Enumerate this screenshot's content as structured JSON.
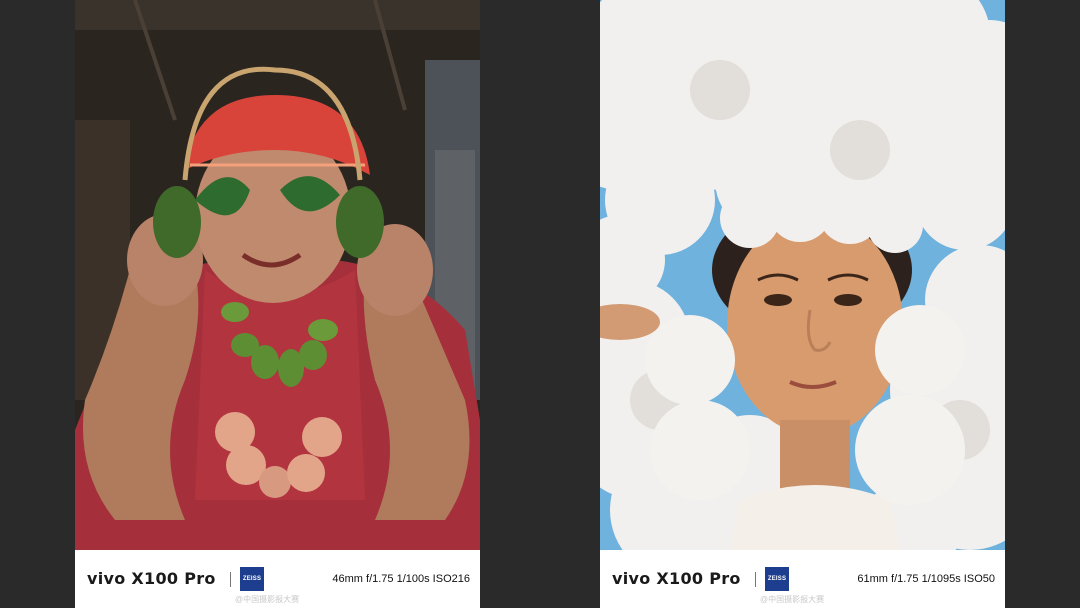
{
  "left_photo": {
    "brand": "vivo X100 Pro",
    "lens_badge": "ZEISS",
    "specs": "46mm  f/1.75  1/100s  ISO216",
    "watermark": "@中国摄影报大赛"
  },
  "right_photo": {
    "brand": "vivo X100 Pro",
    "lens_badge": "ZEISS",
    "specs": "61mm  f/1.75  1/1095s  ISO50",
    "watermark": "@中国摄影报大赛"
  }
}
